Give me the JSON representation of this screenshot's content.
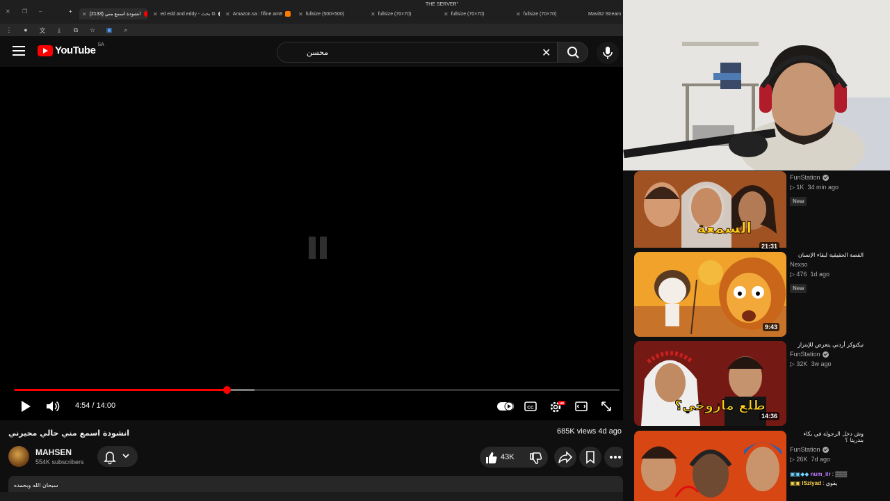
{
  "browser": {
    "window_title": "THE SERVER\"",
    "tabs": [
      {
        "label": "(2133) انشودة اسمع مني",
        "active": true
      },
      {
        "label": "ed edd and eddy - بحث G",
        "active": false
      },
      {
        "label": "Amazon.sa : fifine am8",
        "active": false
      },
      {
        "label": "fullsize (500×500)",
        "active": false
      },
      {
        "label": "fullsize (70×70)",
        "active": false
      },
      {
        "label": "fullsize (70×70)",
        "active": false
      },
      {
        "label": "fullsize (70×70)",
        "active": false
      },
      {
        "label": "Mavi62 Stream",
        "active": false
      }
    ]
  },
  "youtube": {
    "logo_text": "YouTube",
    "country_code": "SA",
    "search_value": "محسن"
  },
  "player": {
    "time_display": "4:54 / 14:00",
    "played_fraction": 0.35,
    "buffered_fraction": 0.397
  },
  "video": {
    "title": "انشودة اسمع مني حالي محيرني",
    "stats": "685K views  4d ago",
    "channel": "MAHSEN",
    "subscribers": "554K subscribers",
    "likes": "43K",
    "description": "سبحان الله وبحمده"
  },
  "sidebar": {
    "items": [
      {
        "title": "",
        "channel": "FunStation",
        "verified": true,
        "views": "1K",
        "age": "34 min ago",
        "badge": "New",
        "duration": "21:31",
        "thumb_text": "السمعة"
      },
      {
        "title": "القصة الحقيقية لبقاء الإنسان",
        "channel": "Nexso",
        "verified": false,
        "views": "476",
        "age": "1d ago",
        "badge": "New",
        "duration": "9:43",
        "thumb_text": ""
      },
      {
        "title": "تيكتوكر أردني يتعرض للإبتزاز",
        "channel": "FunStation",
        "verified": true,
        "views": "32K",
        "age": "3w ago",
        "badge": "",
        "duration": "14:36",
        "thumb_text": "طلع مازوخي؟"
      },
      {
        "title": "وش دخل الرجولة في بكاء بندريتا ؟",
        "channel": "FunStation",
        "verified": true,
        "views": "26K",
        "age": "7d ago",
        "badge": "",
        "duration": "",
        "thumb_text": ""
      }
    ]
  },
  "stream_chat": [
    {
      "user": "num_ilr",
      "text": ""
    },
    {
      "user": "lSziyad",
      "text": "يقوي"
    }
  ],
  "colors": {
    "brand_red": "#ff0000",
    "bg": "#0f0f0f",
    "chip": "#272727"
  }
}
